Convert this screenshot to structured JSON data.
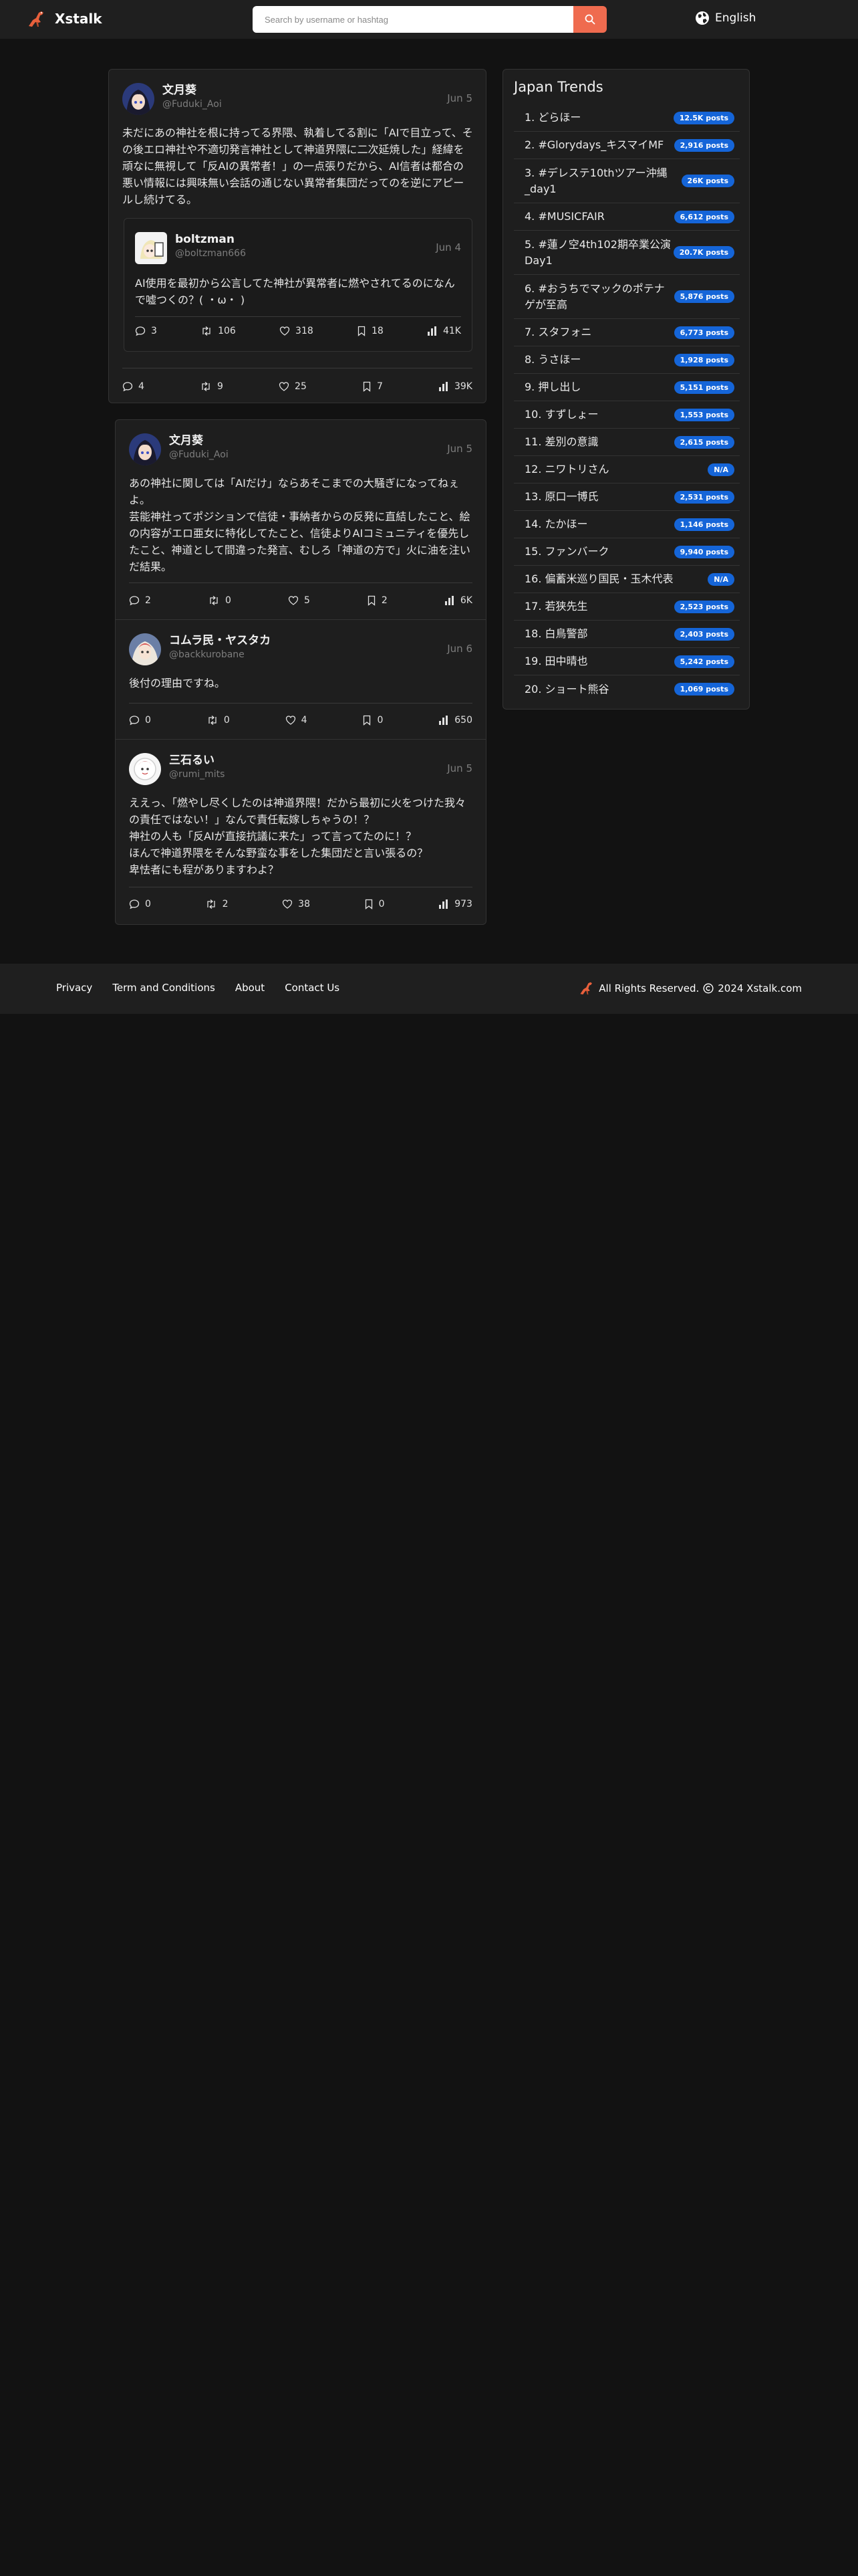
{
  "header": {
    "app_name": "Xstalk",
    "search_placeholder": "Search by username or hashtag",
    "language": "English"
  },
  "main_post": {
    "author": "文月葵",
    "handle": "@Fuduki_Aoi",
    "date": "Jun 5",
    "text": "未だにあの神社を根に持ってる界隈、執着してる割に「AIで目立って、その後エロ神社や不適切発言神社として神道界隈に二次延焼した」経緯を頑なに無視して「反AIの異常者！」の一点張りだから、AI信者は都合の悪い情報には興味無い会話の通じない異常者集団だってのを逆にアピールし続けてる。",
    "quoted": {
      "author": "boltzman",
      "handle": "@boltzman666",
      "date": "Jun 4",
      "text": "AI使用を最初から公言してた神社が異常者に燃やされてるのになんで嘘つくの？( ・ω・ )",
      "stats": {
        "replies": "3",
        "reposts": "106",
        "likes": "318",
        "bookmarks": "18",
        "views": "41K"
      }
    },
    "stats": {
      "replies": "4",
      "reposts": "9",
      "likes": "25",
      "bookmarks": "7",
      "views": "39K"
    }
  },
  "replies": [
    {
      "author": "文月葵",
      "handle": "@Fuduki_Aoi",
      "date": "Jun 5",
      "text": "あの神社に関しては「AIだけ」ならあそこまでの大騒ぎになってねぇよ。\n芸能神社ってポジションで信徒・事納者からの反発に直結したこと、絵の内容がエロ亜女に特化してたこと、信徒よりAIコミュニティを優先したこと、神道として間違った発言、むしろ「神道の方で」火に油を注いだ結果。",
      "stats": {
        "replies": "2",
        "reposts": "0",
        "likes": "5",
        "bookmarks": "2",
        "views": "6K"
      }
    },
    {
      "author": "コムラ民・ヤスタカ",
      "handle": "@backkurobane",
      "date": "Jun 6",
      "text": "後付の理由ですね。",
      "stats": {
        "replies": "0",
        "reposts": "0",
        "likes": "4",
        "bookmarks": "0",
        "views": "650"
      }
    },
    {
      "author": "三石るい",
      "handle": "@rumi_mits",
      "date": "Jun 5",
      "text": "ええっ、「燃やし尽くしたのは神道界隈！だから最初に火をつけた我々の責任ではない！」なんで責任転嫁しちゃうの！？\n神社の人も「反AIが直接抗議に来た」って言ってたのに！？\nほんで神道界隈をそんな野蛮な事をした集団だと言い張るの？\n卑怯者にも程がありますわよ？",
      "stats": {
        "replies": "0",
        "reposts": "2",
        "likes": "38",
        "bookmarks": "0",
        "views": "973"
      }
    }
  ],
  "trends": {
    "title": "Japan Trends",
    "items": [
      {
        "label": "1. どらほー",
        "count": "12.5K posts"
      },
      {
        "label": "2. #Glorydays_キスマイMF",
        "count": "2,916 posts"
      },
      {
        "label": "3. #デレステ10thツアー沖縄_day1",
        "count": "26K posts"
      },
      {
        "label": "4. #MUSICFAIR",
        "count": "6,612 posts"
      },
      {
        "label": "5. #蓮ノ空4th102期卒業公演Day1",
        "count": "20.7K posts"
      },
      {
        "label": "6. #おうちでマックのポテナゲが至高",
        "count": "5,876 posts"
      },
      {
        "label": "7. スタフォニ",
        "count": "6,773 posts"
      },
      {
        "label": "8. うさほー",
        "count": "1,928 posts"
      },
      {
        "label": "9. 押し出し",
        "count": "5,151 posts"
      },
      {
        "label": "10. すずしょー",
        "count": "1,553 posts"
      },
      {
        "label": "11. 差別の意識",
        "count": "2,615 posts"
      },
      {
        "label": "12. ニワトリさん",
        "count": "N/A"
      },
      {
        "label": "13. 原口一博氏",
        "count": "2,531 posts"
      },
      {
        "label": "14. たかほー",
        "count": "1,146 posts"
      },
      {
        "label": "15. ファンバーク",
        "count": "9,940 posts"
      },
      {
        "label": "16. 偏蓄米巡り国民・玉木代表",
        "count": "N/A"
      },
      {
        "label": "17. 若狭先生",
        "count": "2,523 posts"
      },
      {
        "label": "18. 白鳥警部",
        "count": "2,403 posts"
      },
      {
        "label": "19. 田中晴也",
        "count": "5,242 posts"
      },
      {
        "label": "20. ショート熊谷",
        "count": "1,069 posts"
      }
    ]
  },
  "footer": {
    "links": [
      "Privacy",
      "Term and Conditions",
      "About",
      "Contact Us"
    ],
    "rights": "All Rights Reserved.",
    "copyright": "2024 Xstalk.com"
  }
}
